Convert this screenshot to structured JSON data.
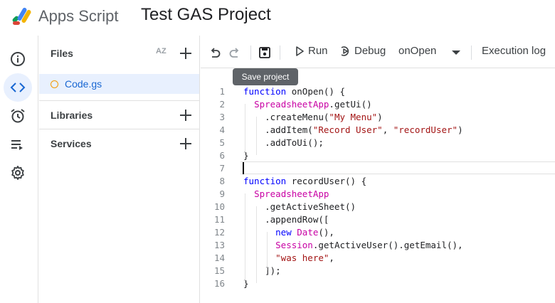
{
  "header": {
    "app_name": "Apps Script",
    "project_title": "Test GAS Project",
    "logo_icon": "apps-script-logo"
  },
  "rail": {
    "items": [
      {
        "icon": "info-icon",
        "label": "Overview"
      },
      {
        "icon": "code-icon",
        "label": "Editor",
        "active": true
      },
      {
        "icon": "alarm-clock-icon",
        "label": "Triggers"
      },
      {
        "icon": "executions-icon",
        "label": "Executions"
      },
      {
        "icon": "gear-icon",
        "label": "Project Settings"
      }
    ]
  },
  "files_panel": {
    "title": "Files",
    "sort_icon": "AZ",
    "files": [
      {
        "name": "Code.gs",
        "selected": true
      }
    ],
    "sections": [
      {
        "title": "Libraries"
      },
      {
        "title": "Services"
      }
    ]
  },
  "toolbar": {
    "run_label": "Run",
    "debug_label": "Debug",
    "function_select": "onOpen",
    "execution_log_label": "Execution log"
  },
  "tooltip": {
    "text": "Save project"
  },
  "editor": {
    "current_line": 7,
    "lines": [
      {
        "n": "1",
        "text": "function onOpen() {"
      },
      {
        "n": "2",
        "text": "  SpreadsheetApp.getUi()"
      },
      {
        "n": "3",
        "text": "    .createMenu(\"My Menu\")"
      },
      {
        "n": "4",
        "text": "    .addItem(\"Record User\", \"recordUser\")"
      },
      {
        "n": "5",
        "text": "    .addToUi();"
      },
      {
        "n": "6",
        "text": "}"
      },
      {
        "n": "7",
        "text": ""
      },
      {
        "n": "8",
        "text": "function recordUser() {"
      },
      {
        "n": "9",
        "text": "  SpreadsheetApp"
      },
      {
        "n": "10",
        "text": "    .getActiveSheet()"
      },
      {
        "n": "11",
        "text": "    .appendRow(["
      },
      {
        "n": "12",
        "text": "      new Date(),"
      },
      {
        "n": "13",
        "text": "      Session.getActiveUser().getEmail(),"
      },
      {
        "n": "14",
        "text": "      \"was here\","
      },
      {
        "n": "15",
        "text": "    ]);"
      },
      {
        "n": "16",
        "text": "}"
      }
    ]
  },
  "colors": {
    "keyword": "#0000ff",
    "class": "#c800a4",
    "string": "#a31515",
    "active_bg": "#e8f0fe",
    "accent": "#1967d2"
  }
}
